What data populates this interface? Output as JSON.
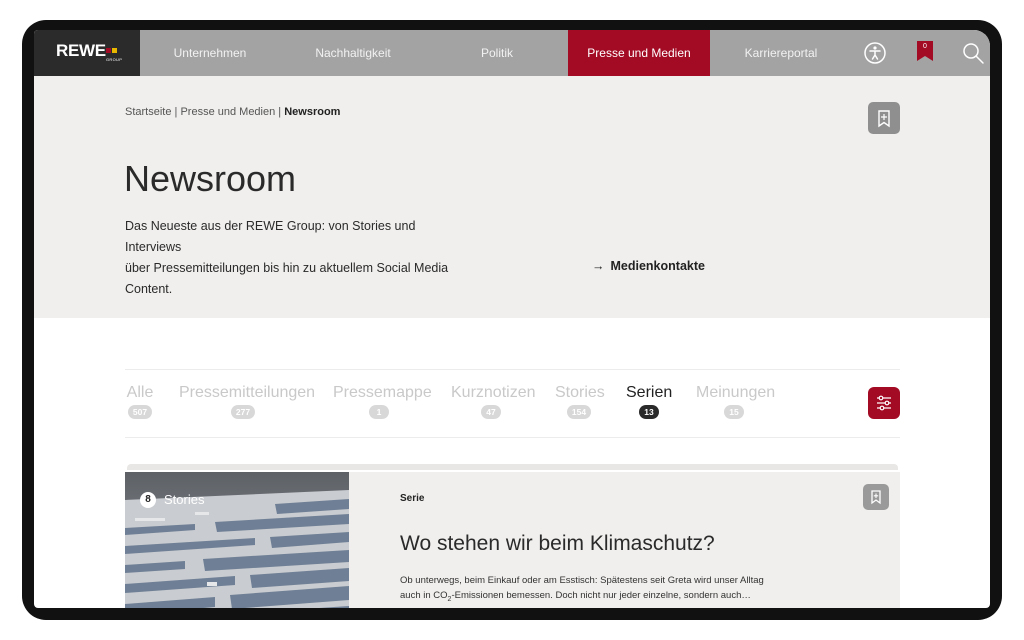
{
  "nav": {
    "logo": "REWE",
    "logo_sub": "GROUP",
    "items": [
      {
        "label": "Unternehmen"
      },
      {
        "label": "Nachhaltigkeit"
      },
      {
        "label": "Politik"
      },
      {
        "label": "Presse und Medien"
      },
      {
        "label": "Karriereportal"
      }
    ],
    "bookmarks_count": "0",
    "icons": [
      "accessibility-icon",
      "bookmark-list-icon",
      "search-icon"
    ],
    "accent_color": "#a30a24"
  },
  "breadcrumb": {
    "items": [
      "Startseite",
      "Presse und Medien",
      "Newsroom"
    ],
    "separator": "|"
  },
  "hero": {
    "title": "Newsroom",
    "intro_lines": [
      "Das Neueste aus der REWE Group: von Stories und Interviews",
      "über Pressemitteilungen bis hin zu aktuellem Social Media",
      "Content."
    ],
    "contact_arrow": "→",
    "contact_link": "Medienkontakte"
  },
  "tabs": [
    {
      "label": "Alle",
      "count": "507"
    },
    {
      "label": "Pressemitteilungen",
      "count": "277"
    },
    {
      "label": "Pressemappe",
      "count": "1"
    },
    {
      "label": "Kurznotizen",
      "count": "47"
    },
    {
      "label": "Stories",
      "count": "154"
    },
    {
      "label": "Serien",
      "count": "13"
    },
    {
      "label": "Meinungen",
      "count": "15"
    }
  ],
  "card": {
    "badge_number": "8",
    "badge_label": "Stories",
    "kicker": "Serie",
    "title": "Wo stehen wir beim Klimaschutz?",
    "text_line1": "Ob unterwegs, beim Einkauf oder am Esstisch: Spätestens seit Greta wird unser Alltag",
    "text_line2_pre": "auch in CO",
    "text_line2_sub": "2",
    "text_line2_post": "-Emissionen bemessen. Doch nicht nur jeder einzelne, sondern auch…"
  }
}
